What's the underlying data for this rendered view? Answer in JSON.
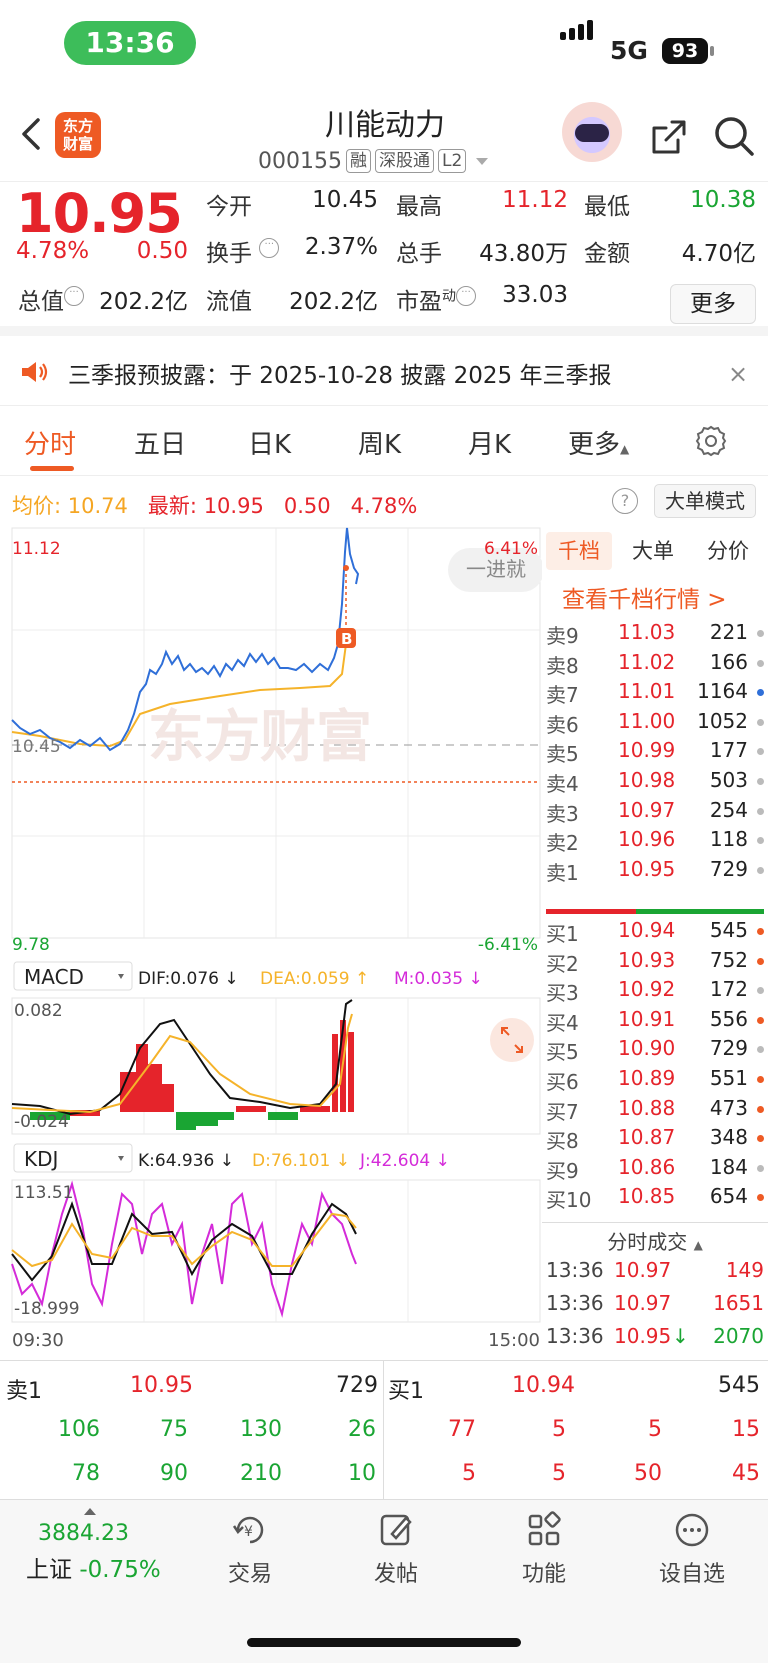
{
  "status_bar": {
    "time": "13:36",
    "network": "5G",
    "battery": "93"
  },
  "header": {
    "logo_text_1": "东方",
    "logo_text_2": "财富",
    "stock_name": "川能动力",
    "stock_code": "000155",
    "tags": [
      "融",
      "深股通",
      "L2"
    ]
  },
  "quote": {
    "price": "10.95",
    "change_pct": "4.78%",
    "change_amt": "0.50",
    "rows": [
      [
        {
          "label": "今开",
          "value": "10.45",
          "color": "#222"
        },
        {
          "label": "最高",
          "value": "11.12",
          "color": "#e5242b"
        },
        {
          "label": "最低",
          "value": "10.38",
          "color": "#1aa533"
        }
      ],
      [
        {
          "label": "换手",
          "value": "2.37%",
          "color": "#222"
        },
        {
          "label": "总手",
          "value": "43.80万",
          "color": "#222"
        },
        {
          "label": "金额",
          "value": "4.70亿",
          "color": "#222"
        }
      ],
      [
        {
          "label": "总值",
          "value": "202.2亿",
          "color": "#222"
        },
        {
          "label": "流值",
          "value": "202.2亿",
          "color": "#222"
        },
        {
          "label": "市盈",
          "value": "33.03",
          "color": "#222"
        }
      ]
    ],
    "pe_superscript": "动",
    "more_label": "更多"
  },
  "notice": {
    "text": "三季报预披露：于 2025-10-28 披露 2025 年三季报",
    "close": "×"
  },
  "tabs": [
    "分时",
    "五日",
    "日K",
    "周K",
    "月K",
    "更多"
  ],
  "info_line": {
    "avg_label": "均价:",
    "avg_value": "10.74",
    "latest_label": "最新:",
    "latest_value": "10.95",
    "change_amt": "0.50",
    "change_pct": "4.78%"
  },
  "big_order_mode": "大单模式",
  "chart": {
    "price_high": "11.12",
    "price_low": "9.78",
    "pct_high": "6.41%",
    "pct_low": "-6.41%",
    "prev_close_label": "10.45",
    "watermark": "东方财富",
    "floating_chip": "一进就",
    "buy_marker": "B",
    "macd": {
      "name": "MACD",
      "dif": "DIF:0.076 ↓",
      "dea": "DEA:0.059 ↑",
      "m": "M:0.035 ↓",
      "top": "0.082",
      "bottom": "-0.024"
    },
    "kdj": {
      "name": "KDJ",
      "k": "K:64.936 ↓",
      "d": "D:76.101 ↓",
      "j": "J:42.604 ↓",
      "top": "113.51",
      "bottom": "-18.999"
    },
    "time_start": "09:30",
    "time_end": "15:00",
    "colors": {
      "price_line": "#2f6fd8",
      "avg_line": "#f5b32a",
      "up": "#e5242b",
      "down": "#1aa533",
      "k": "#111111",
      "d": "#f5b32a",
      "j": "#d42bd9"
    }
  },
  "order_book": {
    "tabs": [
      "千档",
      "大单",
      "分价"
    ],
    "link": "查看千档行情 >",
    "sells": [
      {
        "label": "卖9",
        "price": "11.03",
        "vol": "221",
        "dot": "#bbbbbb"
      },
      {
        "label": "卖8",
        "price": "11.02",
        "vol": "166",
        "dot": "#bbbbbb"
      },
      {
        "label": "卖7",
        "price": "11.01",
        "vol": "1164",
        "dot": "#2f6fd8"
      },
      {
        "label": "卖6",
        "price": "11.00",
        "vol": "1052",
        "dot": "#bbbbbb"
      },
      {
        "label": "卖5",
        "price": "10.99",
        "vol": "177",
        "dot": "#bbbbbb"
      },
      {
        "label": "卖4",
        "price": "10.98",
        "vol": "503",
        "dot": "#bbbbbb"
      },
      {
        "label": "卖3",
        "price": "10.97",
        "vol": "254",
        "dot": "#bbbbbb"
      },
      {
        "label": "卖2",
        "price": "10.96",
        "vol": "118",
        "dot": "#bbbbbb"
      },
      {
        "label": "卖1",
        "price": "10.95",
        "vol": "729",
        "dot": "#bbbbbb"
      }
    ],
    "buys": [
      {
        "label": "买1",
        "price": "10.94",
        "vol": "545",
        "dot": "#ee5a24"
      },
      {
        "label": "买2",
        "price": "10.93",
        "vol": "752",
        "dot": "#ee5a24"
      },
      {
        "label": "买3",
        "price": "10.92",
        "vol": "172",
        "dot": "#bbbbbb"
      },
      {
        "label": "买4",
        "price": "10.91",
        "vol": "556",
        "dot": "#ee5a24"
      },
      {
        "label": "买5",
        "price": "10.90",
        "vol": "729",
        "dot": "#bbbbbb"
      },
      {
        "label": "买6",
        "price": "10.89",
        "vol": "551",
        "dot": "#ee5a24"
      },
      {
        "label": "买7",
        "price": "10.88",
        "vol": "473",
        "dot": "#ee5a24"
      },
      {
        "label": "买8",
        "price": "10.87",
        "vol": "348",
        "dot": "#ee5a24"
      },
      {
        "label": "买9",
        "price": "10.86",
        "vol": "184",
        "dot": "#bbbbbb"
      },
      {
        "label": "买10",
        "price": "10.85",
        "vol": "654",
        "dot": "#ee5a24"
      }
    ],
    "trades_title": "分时成交",
    "trades": [
      {
        "time": "13:36",
        "price": "10.97",
        "vol": "149",
        "arrow": "",
        "vol_color": "#e5242b"
      },
      {
        "time": "13:36",
        "price": "10.97",
        "vol": "1651",
        "arrow": "",
        "vol_color": "#e5242b"
      },
      {
        "time": "13:36",
        "price": "10.95",
        "vol": "2070",
        "arrow": "↓",
        "vol_color": "#1aa533"
      }
    ]
  },
  "level1": {
    "sell": {
      "label": "卖1",
      "price": "10.95",
      "vol": "729",
      "row1": [
        "106",
        "75",
        "130",
        "26"
      ],
      "row2": [
        "78",
        "90",
        "210",
        "10"
      ]
    },
    "buy": {
      "label": "买1",
      "price": "10.94",
      "vol": "545",
      "row1": [
        "77",
        "5",
        "5",
        "15"
      ],
      "row2": [
        "5",
        "5",
        "50",
        "45"
      ]
    }
  },
  "bottom_nav": {
    "index_value": "3884.23",
    "index_name": "上证",
    "index_change": "-0.75%",
    "items": [
      "交易",
      "发帖",
      "功能",
      "设自选"
    ]
  }
}
